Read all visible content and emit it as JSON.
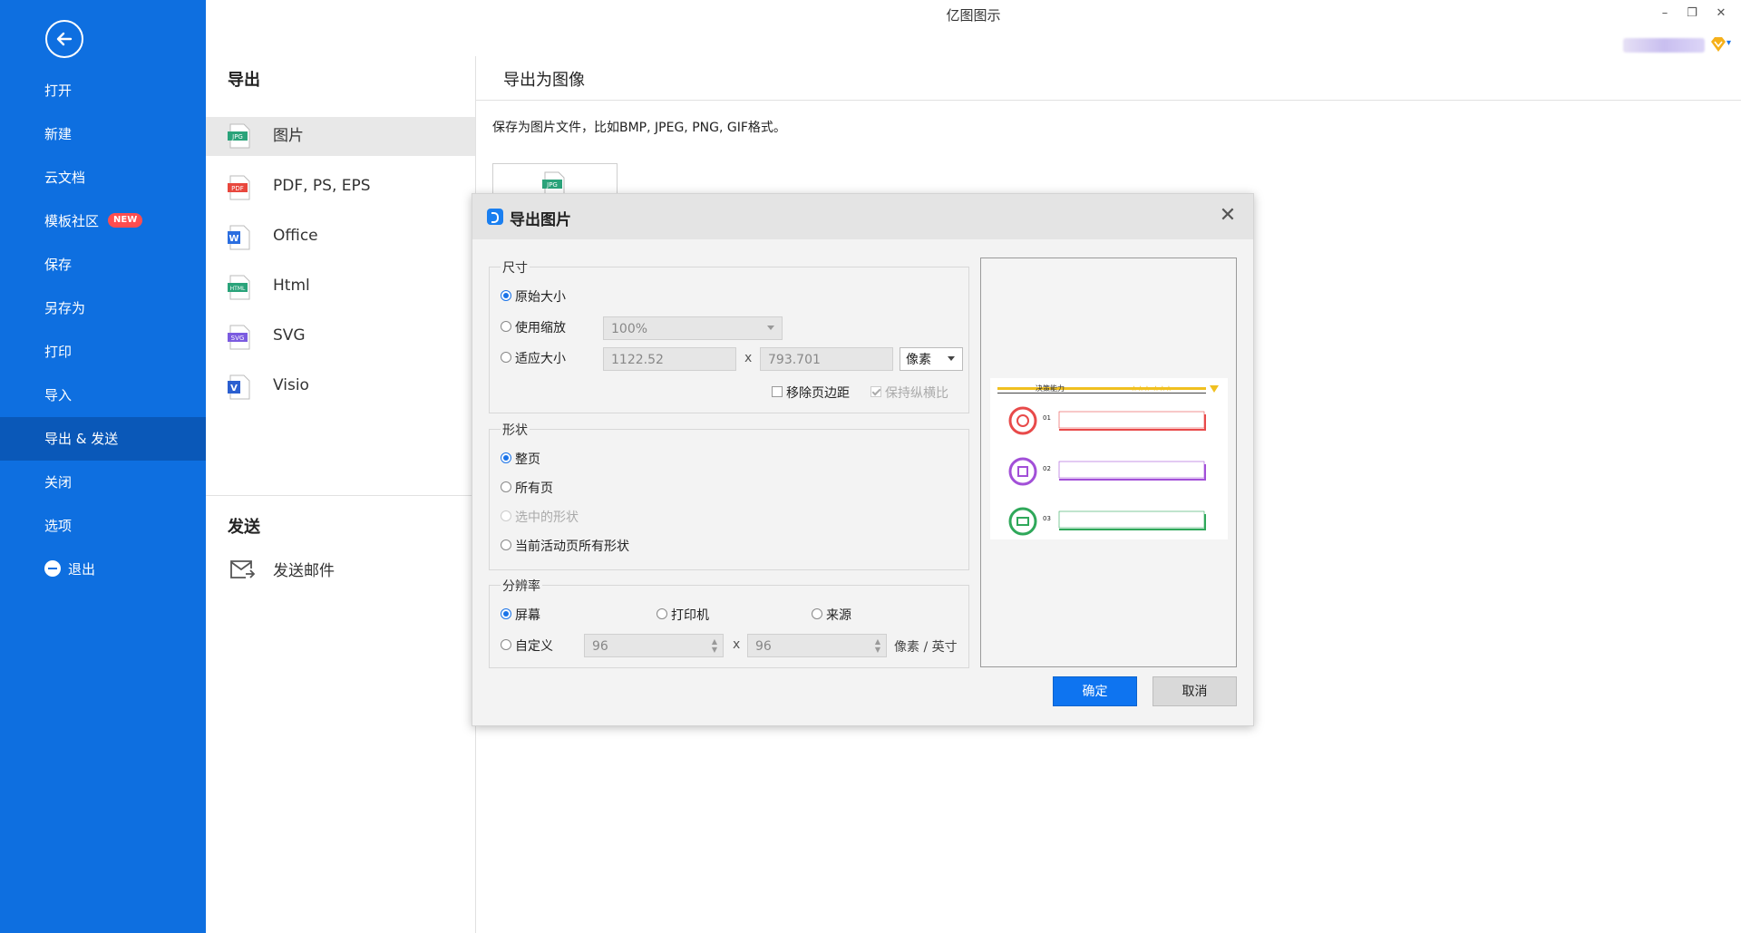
{
  "window": {
    "title": "亿图图示",
    "minimize": "–",
    "restore": "❐",
    "close": "✕"
  },
  "sidebar": {
    "items": [
      {
        "label": "打开"
      },
      {
        "label": "新建"
      },
      {
        "label": "云文档"
      },
      {
        "label": "模板社区",
        "badge": "NEW"
      },
      {
        "label": "保存"
      },
      {
        "label": "另存为"
      },
      {
        "label": "打印"
      },
      {
        "label": "导入"
      },
      {
        "label": "导出 & 发送",
        "active": true
      },
      {
        "label": "关闭"
      },
      {
        "label": "选项"
      },
      {
        "label": "退出"
      }
    ]
  },
  "export_panel": {
    "title": "导出",
    "items": [
      {
        "label": "图片",
        "icon": "JPG",
        "color": "#2aa37a"
      },
      {
        "label": "PDF, PS, EPS",
        "icon": "PDF",
        "color": "#e8473d"
      },
      {
        "label": "Office",
        "icon": "W",
        "color": "#2b6ee0"
      },
      {
        "label": "Html",
        "icon": "HTML",
        "color": "#2aa37a"
      },
      {
        "label": "SVG",
        "icon": "SVG",
        "color": "#7b5be0"
      },
      {
        "label": "Visio",
        "icon": "V",
        "color": "#2b5fd0"
      }
    ],
    "send_title": "发送",
    "send_item": "发送邮件"
  },
  "content": {
    "title": "导出为图像",
    "description": "保存为图片文件，比如BMP, JPEG, PNG, GIF格式。",
    "thumb_icon": "JPG"
  },
  "dialog": {
    "title": "导出图片",
    "close": "✕",
    "size": {
      "legend": "尺寸",
      "original": "原始大小",
      "use_scale": "使用缩放",
      "scale_value": "100%",
      "fit_size": "适应大小",
      "width": "1122.52",
      "times": "x",
      "height": "793.701",
      "unit": "像素",
      "remove_margin": "移除页边距",
      "keep_ratio": "保持纵横比"
    },
    "shape": {
      "legend": "形状",
      "whole_page": "整页",
      "all_pages": "所有页",
      "selected": "选中的形状",
      "current_page_all": "当前活动页所有形状"
    },
    "resolution": {
      "legend": "分辨率",
      "screen": "屏幕",
      "printer": "打印机",
      "source": "来源",
      "custom": "自定义",
      "dpi_x": "96",
      "times": "x",
      "dpi_y": "96",
      "unit": "像素 / 英寸"
    },
    "preview_heading": "决策能力",
    "preview_items": [
      "01",
      "02",
      "03"
    ],
    "ok": "确定",
    "cancel": "取消"
  },
  "colors": {
    "sidebar": "#0e6fe0",
    "sidebar_active": "#0a58b8",
    "accent": "#0e74f0",
    "badge": "#ff4d4f"
  }
}
